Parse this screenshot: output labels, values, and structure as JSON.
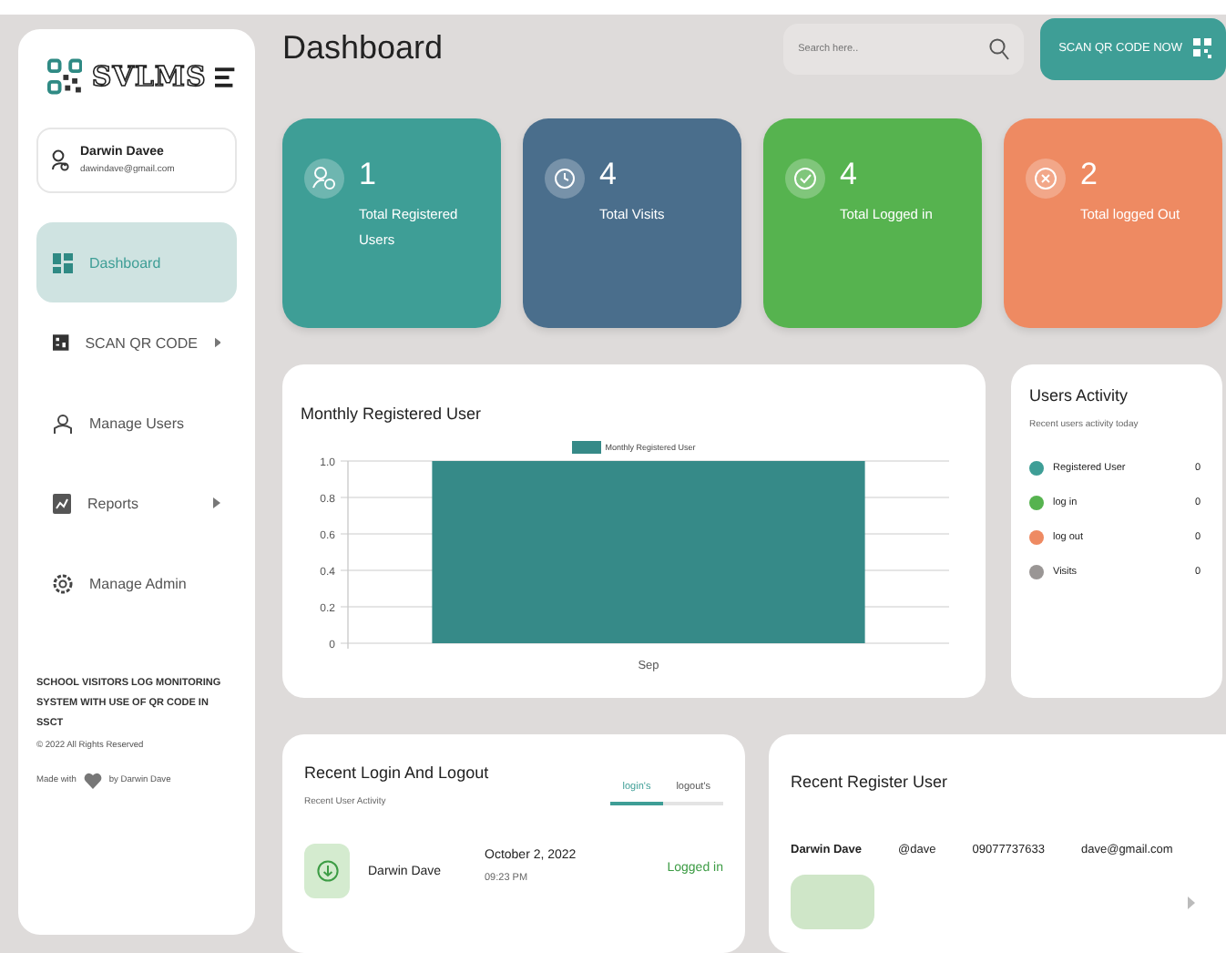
{
  "sidebar": {
    "logo": "SVLMS",
    "profile": {
      "name": "Darwin Davee",
      "email": "dawindave@gmail.com"
    },
    "items": [
      {
        "label": "Dashboard",
        "kind": "grid",
        "submenu": false,
        "selected": true
      },
      {
        "label": "SCAN QR CODE",
        "kind": "qr",
        "submenu": true,
        "selected": false
      },
      {
        "label": "Manage Users",
        "kind": "users",
        "submenu": false,
        "selected": false
      },
      {
        "label": "Reports",
        "kind": "report",
        "submenu": true,
        "selected": false
      },
      {
        "label": "Manage Admin",
        "kind": "gear",
        "submenu": false,
        "selected": false
      }
    ],
    "footer": {
      "title": "SCHOOL VISITORS LOG MONITORING SYSTEM WITH USE OF QR CODE IN SSCT",
      "copyright": "© 2022 All Rights Reserved",
      "made_with": "Made with",
      "by": "by Darwin Dave"
    }
  },
  "header": {
    "title": "Dashboard",
    "search": {
      "placeholder": "Search here.."
    },
    "button": "SCAN QR CODE NOW"
  },
  "stats": [
    {
      "value": "1",
      "label": "Total Registered Users",
      "color": "#3e9e96",
      "kind": "users"
    },
    {
      "value": "4",
      "label": "Total Visits",
      "color": "#4a6e8c",
      "kind": "visits"
    },
    {
      "value": "4",
      "label": "Total Logged in",
      "color": "#56b34f",
      "kind": "login"
    },
    {
      "value": "2",
      "label": "Total logged Out",
      "color": "#ee8a62",
      "kind": "logout"
    }
  ],
  "monthly": {
    "title": "Monthly Registered User",
    "chart_data": {
      "type": "bar",
      "categories": [
        "Sep"
      ],
      "series": [
        {
          "name": "Monthly Registered User",
          "color": "#368a88",
          "values": [
            1
          ]
        }
      ],
      "grid": true,
      "ylim": [
        0,
        1
      ],
      "yticks": [
        0,
        0.2,
        0.4,
        0.6,
        0.8,
        {
          "value": 1,
          "label": "1.0"
        }
      ]
    }
  },
  "activity": {
    "title": "Users Activity",
    "subtitle": "Recent users activity today",
    "items": [
      {
        "label": "Registered User",
        "value": "0",
        "color": "#3e9e96"
      },
      {
        "label": "log in",
        "value": "0",
        "color": "#56b34f"
      },
      {
        "label": "log out",
        "value": "0",
        "color": "#ee8a62"
      },
      {
        "label": "Visits",
        "value": "0",
        "color": "#9a9695"
      }
    ]
  },
  "recent_login": {
    "title": "Recent Login And Logout",
    "subtitle": "Recent User Activity",
    "tabs": [
      {
        "label": "login's",
        "selected": true
      },
      {
        "label": "logout's",
        "selected": false
      }
    ],
    "rows": [
      {
        "name": "Darwin Dave",
        "date": "October 2, 2022",
        "time": "09:23 PM",
        "status": "Logged in"
      }
    ]
  },
  "recent_register": {
    "title": "Recent Register User",
    "rows": [
      {
        "name": "Darwin Dave",
        "username": "@dave",
        "phone": "09077737633",
        "email": "dave@gmail.com"
      }
    ]
  }
}
